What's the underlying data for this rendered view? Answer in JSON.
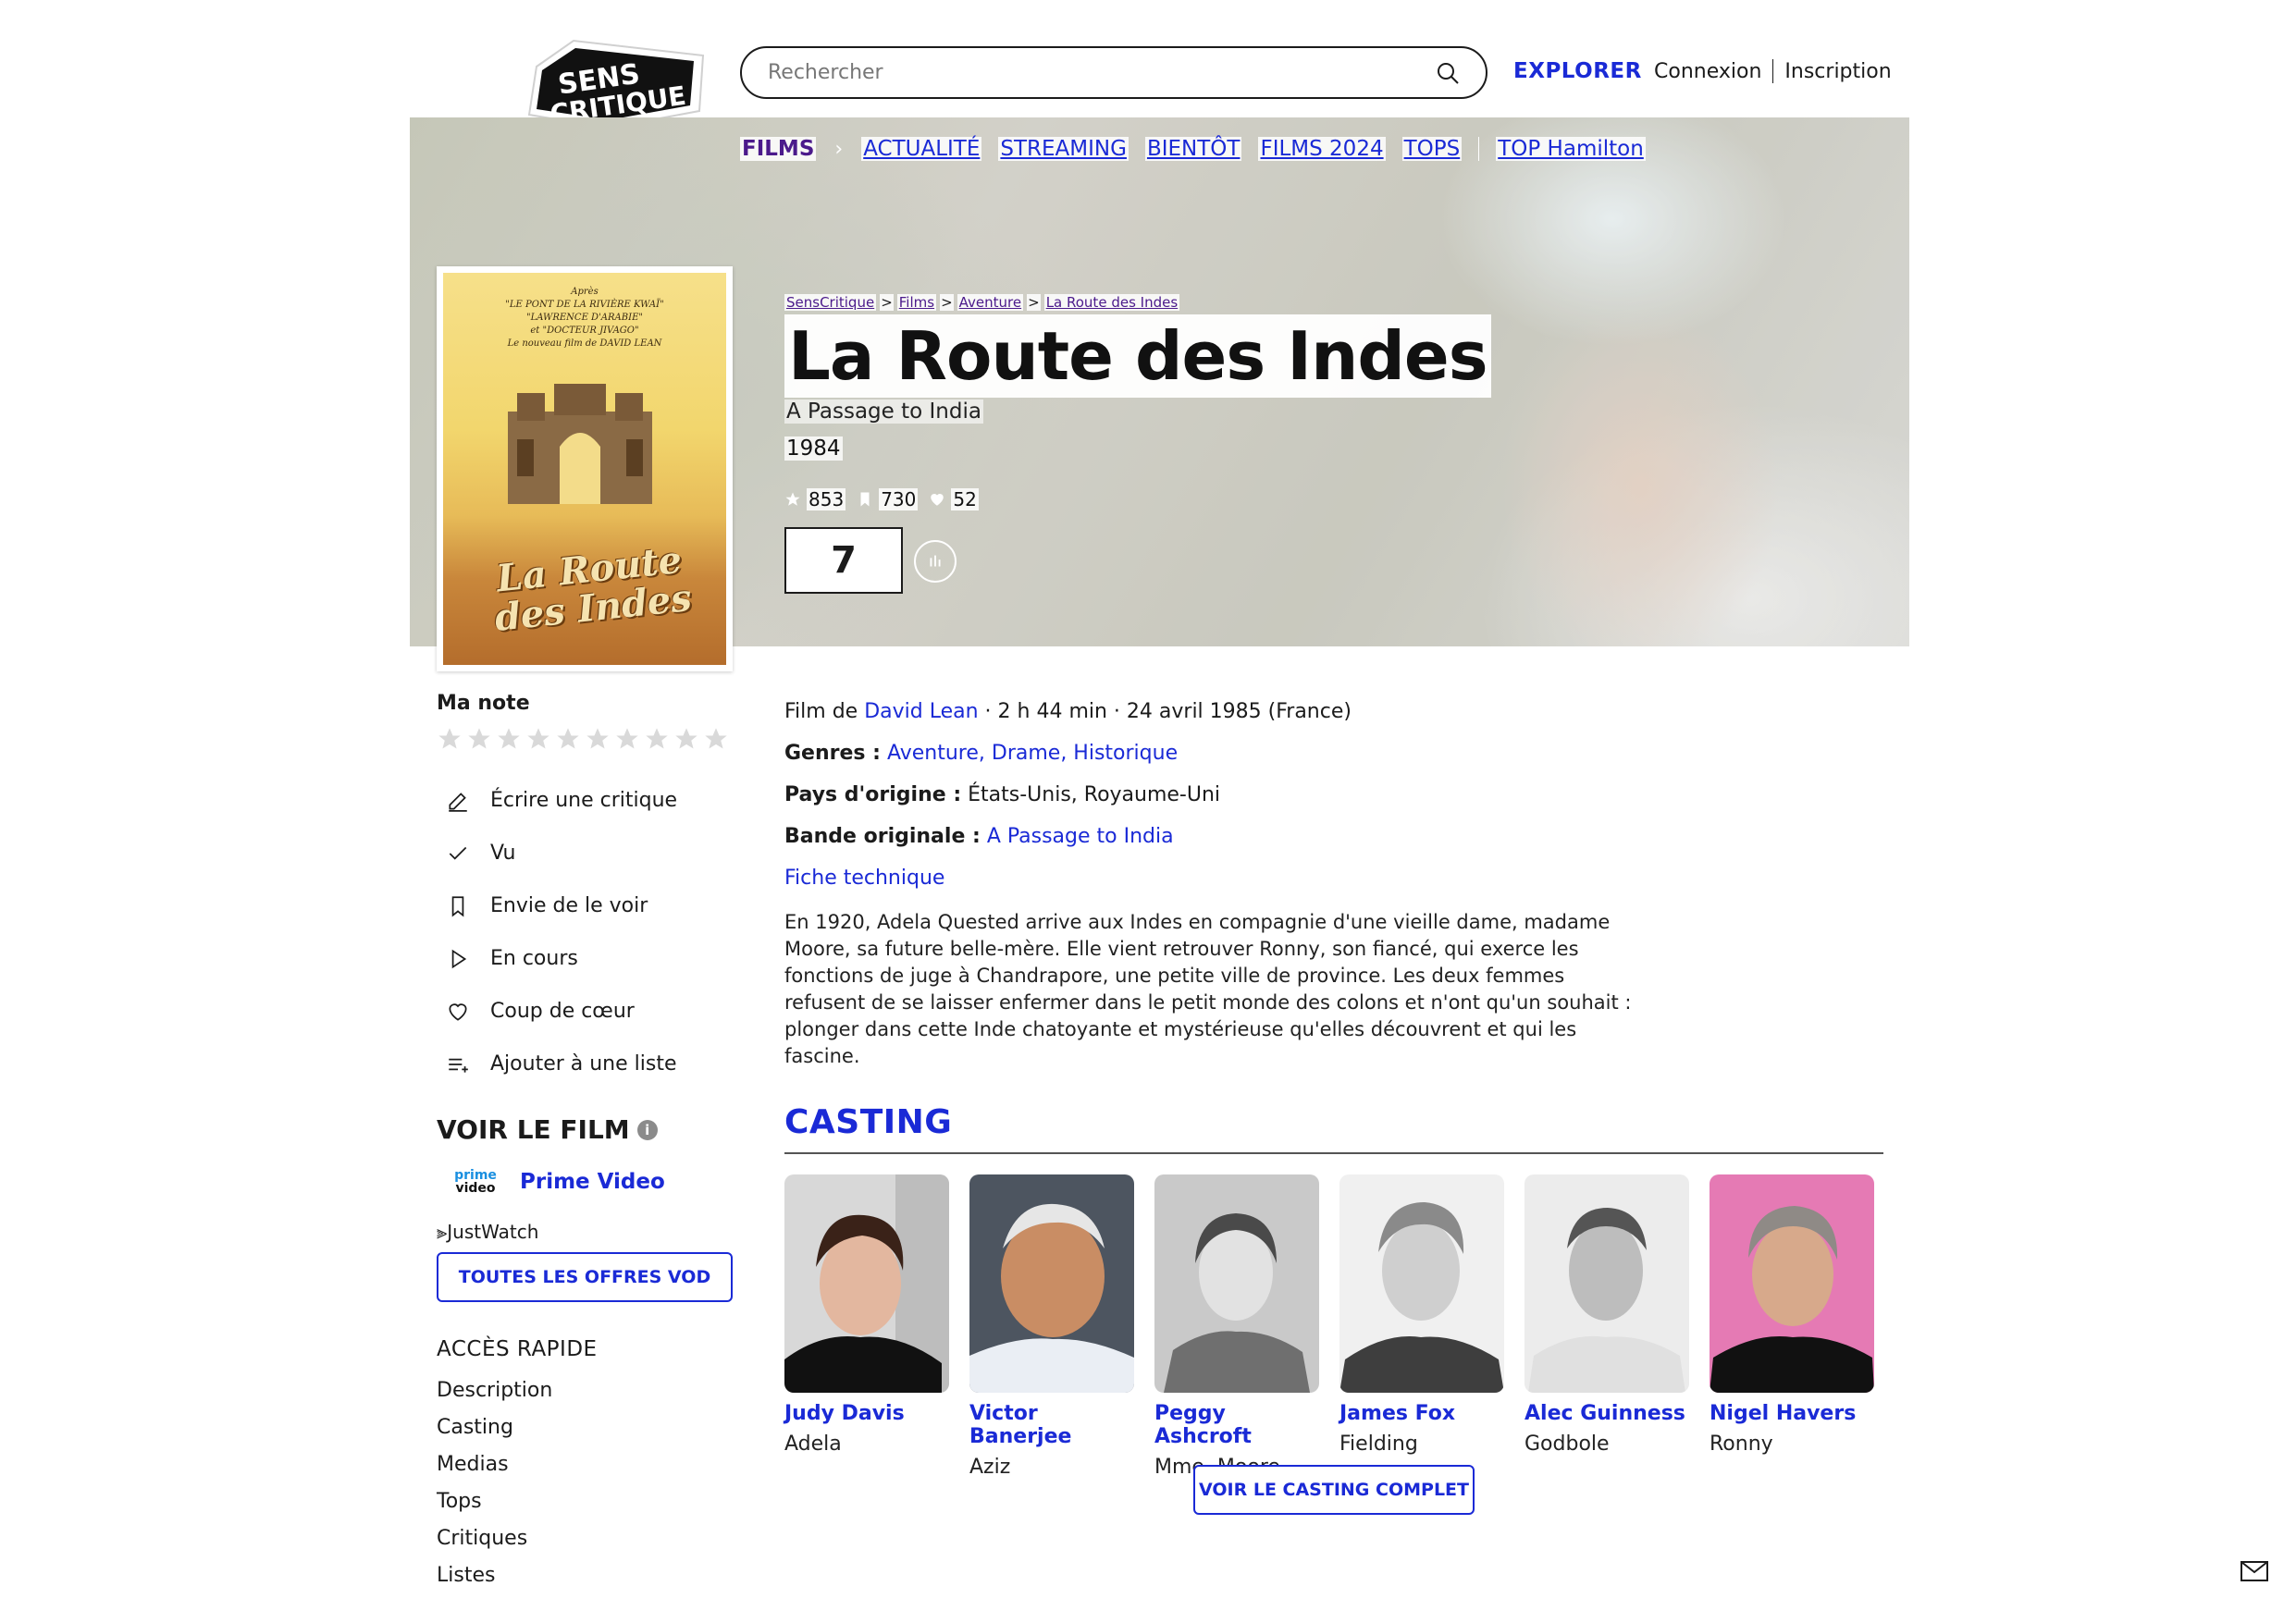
{
  "header": {
    "logo_line1": "SENS",
    "logo_line2": "CRITIQUE",
    "search_placeholder": "Rechercher",
    "explorer": "EXPLORER",
    "connexion": "Connexion",
    "inscription": "Inscription"
  },
  "subnav": {
    "films": "FILMS",
    "items": [
      "ACTUALITÉ",
      "STREAMING",
      "BIENTÔT",
      "FILMS 2024",
      "TOPS",
      "TOP Hamilton"
    ]
  },
  "breadcrumb": [
    "SensCritique",
    "Films",
    "Aventure",
    "La Route des Indes"
  ],
  "poster": {
    "lines": [
      "Après",
      "\"LE PONT DE LA RIVIÈRE KWAÏ\"",
      "\"LAWRENCE D'ARABIE\"",
      "et \"DOCTEUR JIVAGO\"",
      "Le nouveau film de DAVID LEAN"
    ],
    "title": "La Route des Indes"
  },
  "movie": {
    "title": "La Route des Indes",
    "original_title": "A Passage to India",
    "year": "1984",
    "ratings_count": "853",
    "wishlist_count": "730",
    "favorites_count": "52",
    "score": "7"
  },
  "sidebar": {
    "my_rating_label": "Ma note",
    "actions": [
      "Écrire une critique",
      "Vu",
      "Envie de le voir",
      "En cours",
      "Coup de cœur",
      "Ajouter à une liste"
    ],
    "watch_title": "VOIR LE FILM",
    "prime_logo_top": "prime",
    "prime_logo_bottom": "video",
    "prime_label": "Prime Video",
    "justwatch": "JustWatch",
    "vod_button": "TOUTES LES OFFRES VOD",
    "quick_title": "ACCÈS RAPIDE",
    "quick_links": [
      "Description",
      "Casting",
      "Medias",
      "Tops",
      "Critiques",
      "Listes"
    ]
  },
  "details": {
    "film_de_label": "Film de",
    "director": "David Lean",
    "duration_date": " · 2 h 44 min · 24 avril 1985 (France)",
    "genres_label": "Genres :",
    "genres": "Aventure, Drame, Historique",
    "countries_label": "Pays d'origine :",
    "countries": "États-Unis, Royaume-Uni",
    "soundtrack_label": "Bande originale :",
    "soundtrack": "A Passage to India",
    "tech_sheet": "Fiche technique",
    "synopsis": "En 1920, Adela Quested arrive aux Indes en compagnie d'une vieille dame, madame Moore, sa future belle-mère. Elle vient retrouver Ronny, son fiancé, qui exerce les fonctions de juge à Chandrapore, une petite ville de province. Les deux femmes refusent de se laisser enfermer dans le petit monde des colons et n'ont qu'un souhait : plonger dans cette Inde chatoyante et mystérieuse qu'elles découvrent et qui les fascine."
  },
  "casting": {
    "title": "CASTING",
    "actors": [
      {
        "name": "Judy Davis",
        "role": "Adela"
      },
      {
        "name": "Victor Banerjee",
        "role": "Aziz"
      },
      {
        "name": "Peggy Ashcroft",
        "role": "Mme. Moore"
      },
      {
        "name": "James Fox",
        "role": "Fielding"
      },
      {
        "name": "Alec Guinness",
        "role": "Godbole"
      },
      {
        "name": "Nigel Havers",
        "role": "Ronny"
      }
    ],
    "full_cast_button": "VOIR LE CASTING COMPLET"
  },
  "colors": {
    "accent": "#1a2ad6",
    "visited": "#4b1a8b",
    "text": "#1b1b1b"
  }
}
